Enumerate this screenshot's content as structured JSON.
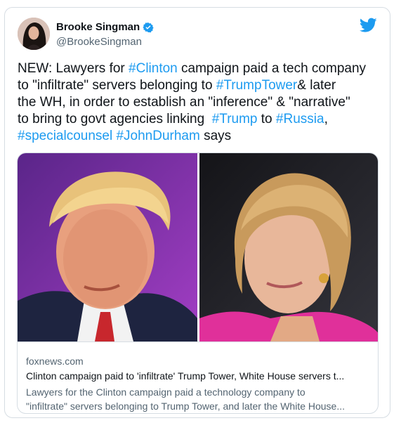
{
  "author": {
    "display_name": "Brooke Singman",
    "handle": "@BrookeSingman",
    "verified": true
  },
  "icons": {
    "verified": "verified-badge-icon",
    "brand": "twitter-bird-icon"
  },
  "tweet": {
    "segments": [
      {
        "text": "NEW: Lawyers for ",
        "type": "text"
      },
      {
        "text": "#Clinton",
        "type": "hashtag"
      },
      {
        "text": " campaign paid a tech company\nto \"infiltrate\" servers belonging to ",
        "type": "text"
      },
      {
        "text": "#TrumpTower",
        "type": "hashtag"
      },
      {
        "text": "& later\nthe WH, in order to establish an \"inference\" & \"narrative\"\nto bring to govt agencies linking  ",
        "type": "text"
      },
      {
        "text": "#Trump",
        "type": "hashtag"
      },
      {
        "text": " to ",
        "type": "text"
      },
      {
        "text": "#Russia",
        "type": "hashtag"
      },
      {
        "text": ",\n",
        "type": "text"
      },
      {
        "text": "#specialcounsel",
        "type": "hashtag"
      },
      {
        "text": " ",
        "type": "text"
      },
      {
        "text": "#JohnDurham",
        "type": "hashtag"
      },
      {
        "text": " says",
        "type": "text"
      }
    ]
  },
  "link_card": {
    "domain": "foxnews.com",
    "title": "Clinton campaign paid to 'infiltrate' Trump Tower, White House servers t...",
    "description_lines": [
      "Lawyers for the Clinton campaign paid a technology company to",
      "\"infiltrate\" servers belonging to Trump Tower, and later the White House..."
    ]
  },
  "colors": {
    "link": "#1d9bf0",
    "secondary_text": "#536471",
    "border": "#d6dde3",
    "left_photo_bg": "#7b2fa3",
    "right_photo_bg": "#1c1c22"
  }
}
